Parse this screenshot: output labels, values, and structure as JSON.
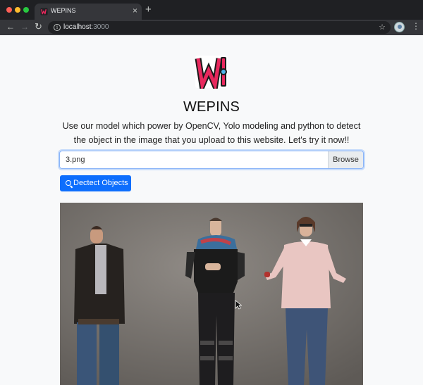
{
  "tab": {
    "title": "WEPINS"
  },
  "address_bar": {
    "host": "localhost",
    "port": ":3000"
  },
  "page": {
    "brand": "WEPINS",
    "subtitle": "Use our model which power by OpenCV, Yolo modeling and python to detect the object in the image that you upload to this website. Let's try it now!!",
    "file_input": {
      "value": "3.png",
      "browse_label": "Browse"
    },
    "detect_button": "Dectect Objects"
  },
  "colors": {
    "accent": "#0d6efd",
    "logo_pink": "#e8285d",
    "chrome_dark": "#1f2023"
  },
  "icons": [
    "search-icon",
    "info-icon",
    "star-icon",
    "back-icon",
    "forward-icon",
    "reload-icon",
    "close-icon",
    "plus-icon",
    "more-icon"
  ]
}
